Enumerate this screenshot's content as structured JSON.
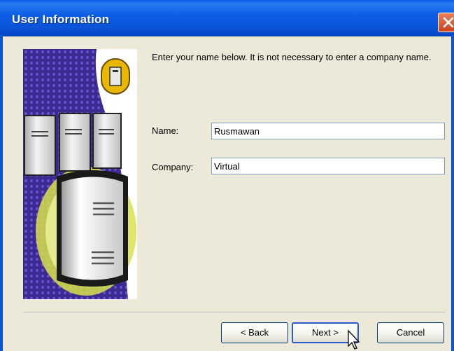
{
  "window": {
    "title": "User Information"
  },
  "intro_text": "Enter your name below.  It is not necessary to enter a company name.",
  "form": {
    "name_label": "Name:",
    "name_value": "Rusmawan",
    "company_label": "Company:",
    "company_value": "Virtual"
  },
  "buttons": {
    "back": "< Back",
    "next": "Next >",
    "cancel": "Cancel"
  },
  "icons": {
    "close": "close-icon",
    "artwork": "server-icon",
    "cursor": "mouse-pointer-icon"
  },
  "colors": {
    "titlebar": "#0A54D8",
    "dialog_bg": "#ECE9D8",
    "close": "#D45A2E"
  }
}
